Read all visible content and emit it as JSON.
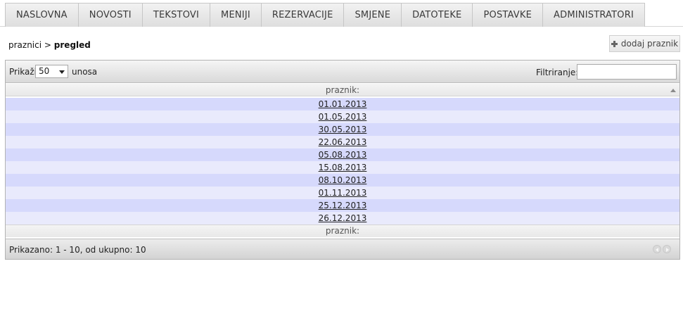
{
  "nav": {
    "tabs": [
      {
        "label": "NASLOVNA"
      },
      {
        "label": "NOVOSTI"
      },
      {
        "label": "TEKSTOVI"
      },
      {
        "label": "MENIJI"
      },
      {
        "label": "REZERVACIJE"
      },
      {
        "label": "SMJENE"
      },
      {
        "label": "DATOTEKE"
      },
      {
        "label": "POSTAVKE"
      },
      {
        "label": "ADMINISTRATORI"
      }
    ]
  },
  "breadcrumb": {
    "parent": "praznici",
    "separator": ">",
    "current": "pregled"
  },
  "actions": {
    "add_label": "dodaj praznik",
    "add_icon": "plus-icon"
  },
  "table": {
    "length": {
      "prefix": "Prikaži",
      "selected": "50",
      "suffix": "unosa"
    },
    "filter": {
      "label": "Filtriranje:",
      "value": ""
    },
    "column_header": "praznik:",
    "column_footer": "praznik:",
    "rows": [
      "01.01.2013",
      "01.05.2013",
      "30.05.2013",
      "22.06.2013",
      "05.08.2013",
      "15.08.2013",
      "08.10.2013",
      "01.11.2013",
      "25.12.2013",
      "26.12.2013"
    ],
    "info": "Prikazano: 1 - 10, od ukupno: 10",
    "row_colors": {
      "odd": "#d6d9fc",
      "even": "#e9eafc"
    }
  }
}
